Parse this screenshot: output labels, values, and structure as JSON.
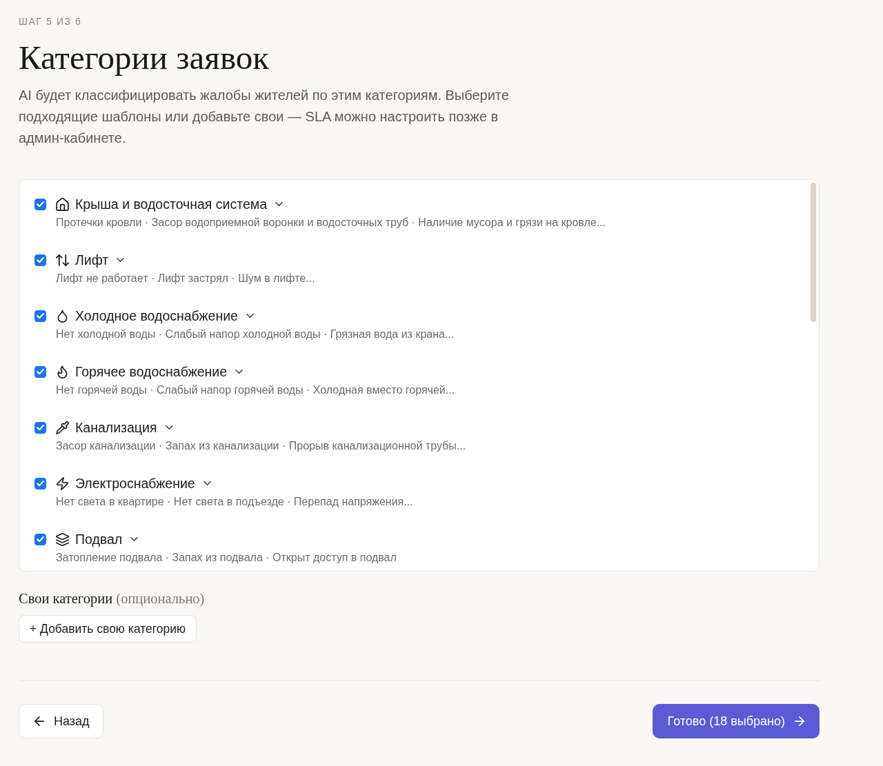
{
  "step": "ШАГ 5 ИЗ 6",
  "title": "Категории заявок",
  "description": "AI будет классифицировать жалобы жителей по этим категориям. Выберите подходящие шаблоны или добавьте свои — SLA можно настроить позже в админ-кабинете.",
  "categories": [
    {
      "title": "Крыша и водосточная система",
      "examples": "Протечки кровли · Засор водоприемной воронки и водосточных труб · Наличие мусора и грязи на кровле...",
      "checked": true
    },
    {
      "title": "Лифт",
      "examples": "Лифт не работает · Лифт застрял · Шум в лифте...",
      "checked": true
    },
    {
      "title": "Холодное водоснабжение",
      "examples": "Нет холодной воды · Слабый напор холодной воды · Грязная вода из крана...",
      "checked": true
    },
    {
      "title": "Горячее водоснабжение",
      "examples": "Нет горячей воды · Слабый напор горячей воды · Холодная вместо горячей...",
      "checked": true
    },
    {
      "title": "Канализация",
      "examples": "Засор канализации · Запах из канализации · Прорыв канализационной трубы...",
      "checked": true
    },
    {
      "title": "Электроснабжение",
      "examples": "Нет света в квартире · Нет света в подъезде · Перепад напряжения...",
      "checked": true
    },
    {
      "title": "Подвал",
      "examples": "Затопление подвала · Запах из подвала · Открыт доступ в подвал",
      "checked": true
    }
  ],
  "custom": {
    "label": "Свои категории",
    "hint": "(опционально)",
    "add_button": "+ Добавить свою категорию"
  },
  "footer": {
    "back_button": "Назад",
    "done_button": "Готово (18 выбрано)"
  }
}
